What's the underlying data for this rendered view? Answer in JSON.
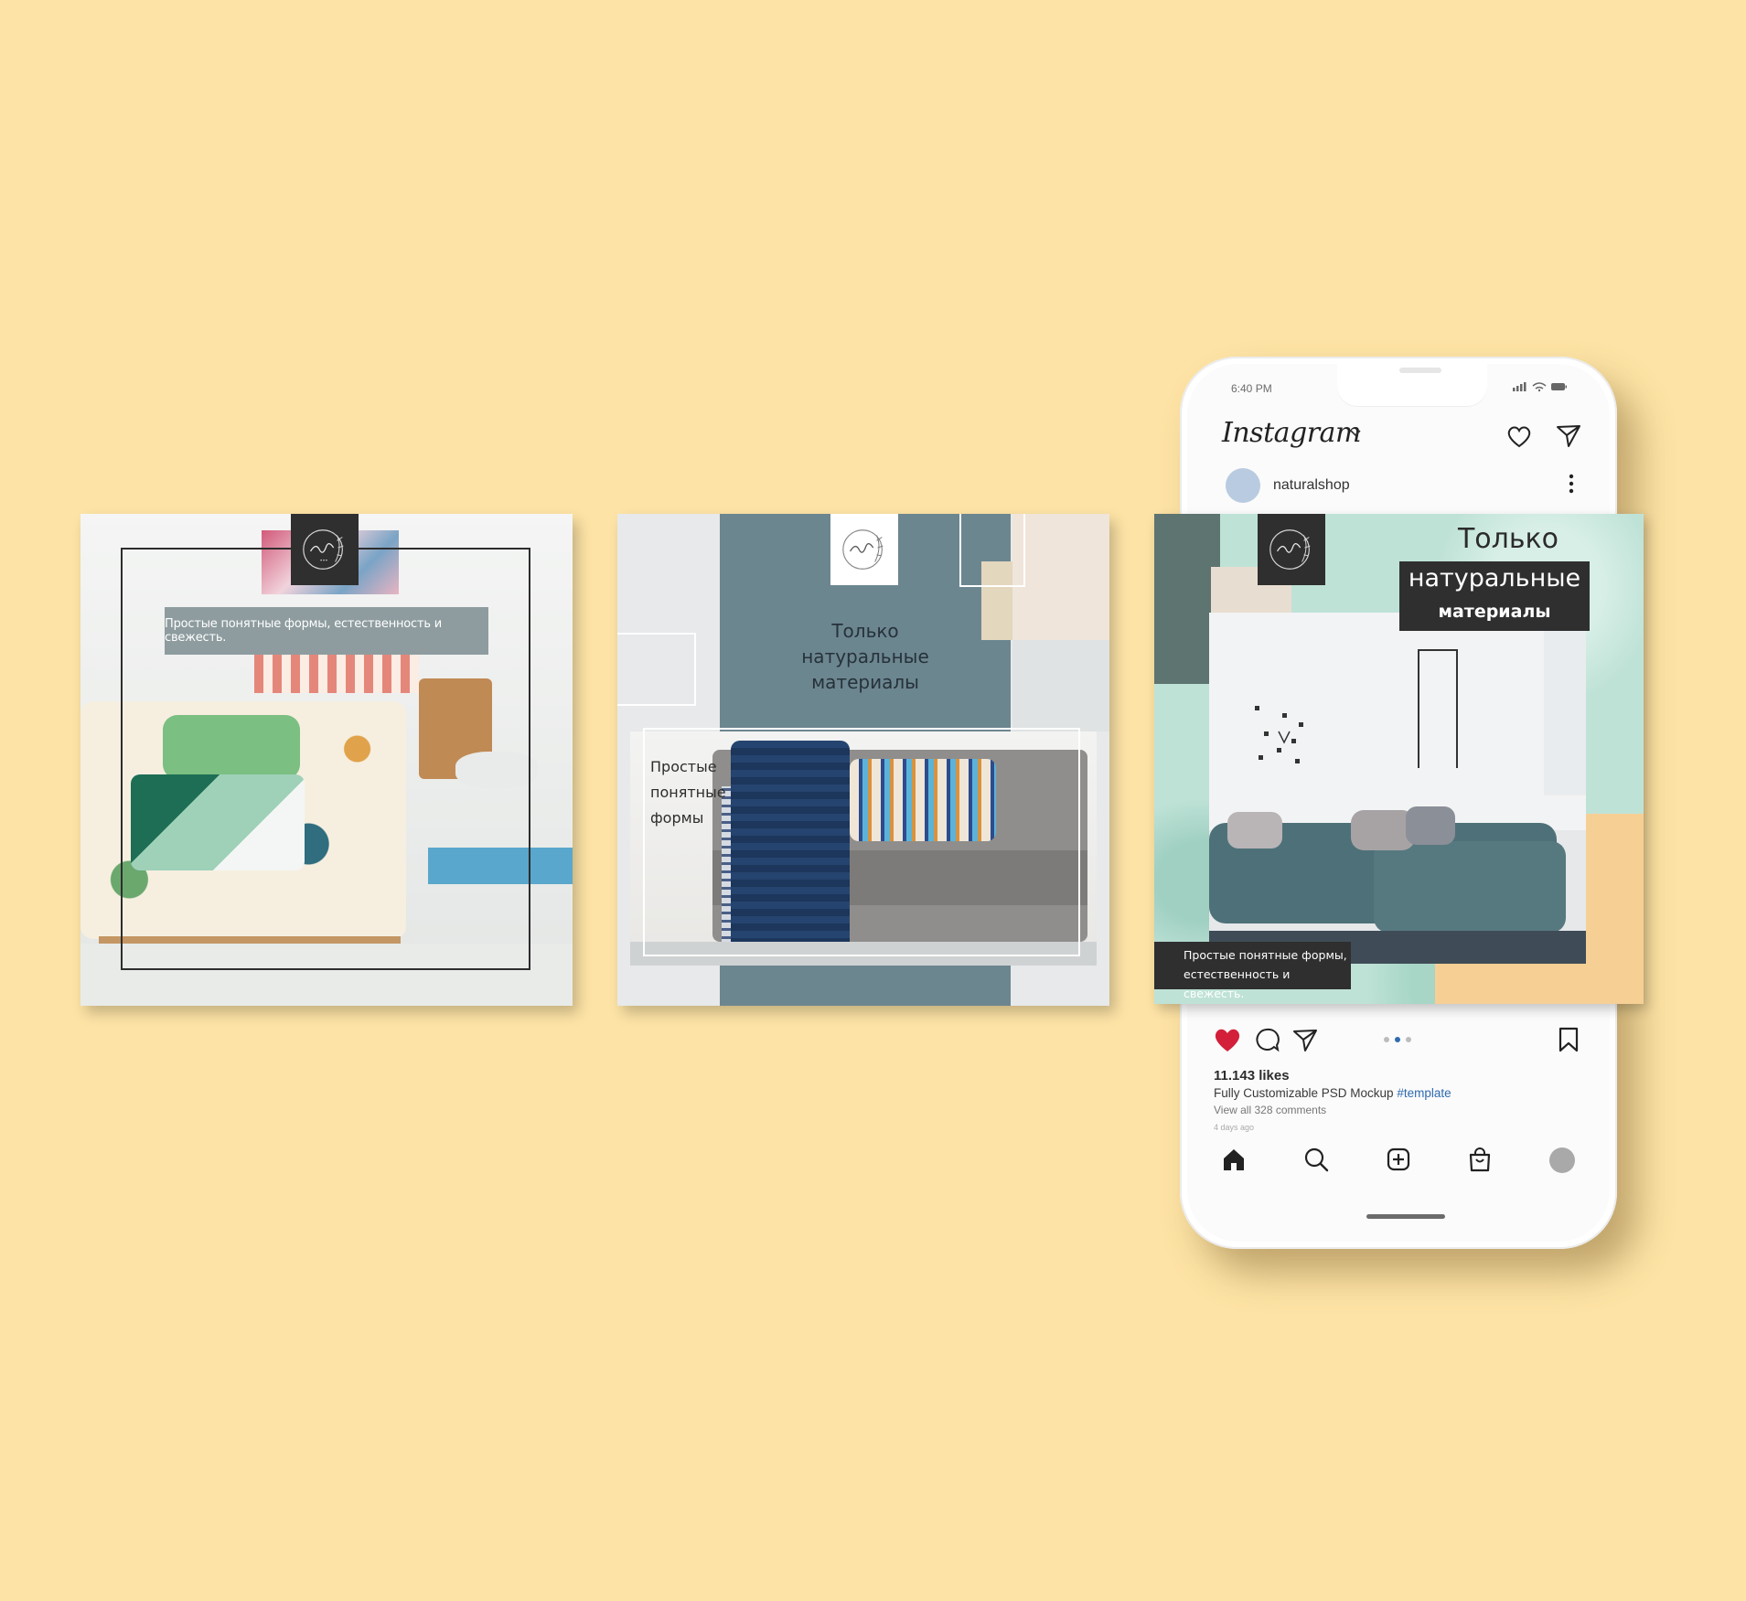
{
  "card1": {
    "logo_icon": "natural-logo-icon",
    "banner_text": "Простые понятные формы, естественность и свежесть."
  },
  "card2": {
    "logo_icon": "natural-logo-icon",
    "title_lines": [
      "Только",
      "натуральные",
      "материалы"
    ],
    "sub_lines": [
      "Простые",
      "понятные",
      "формы"
    ]
  },
  "phone": {
    "status_time": "6:40 PM",
    "app_title": "Instagram",
    "username": "naturalshop",
    "post": {
      "title_line1": "Только",
      "title_line2": "натуральные",
      "title_line3": "материалы",
      "caption_lines": [
        "Простые понятные формы,",
        "естественность и свежесть."
      ]
    },
    "likes": "11.143 likes",
    "caption_text": "Fully Customizable PSD Mockup",
    "caption_tag": "#template",
    "comments_link": "View all 328 comments",
    "time_ago": "4 days ago",
    "carousel_active_index": 1,
    "carousel_count": 3
  },
  "colors": {
    "background": "#fde3a5",
    "teal": "#6c8690",
    "mint": "#bfe2d7",
    "peach": "#f6cf95",
    "dark": "#2f2f30",
    "like_red": "#d31f3a",
    "hashtag_blue": "#2f6bb0"
  }
}
